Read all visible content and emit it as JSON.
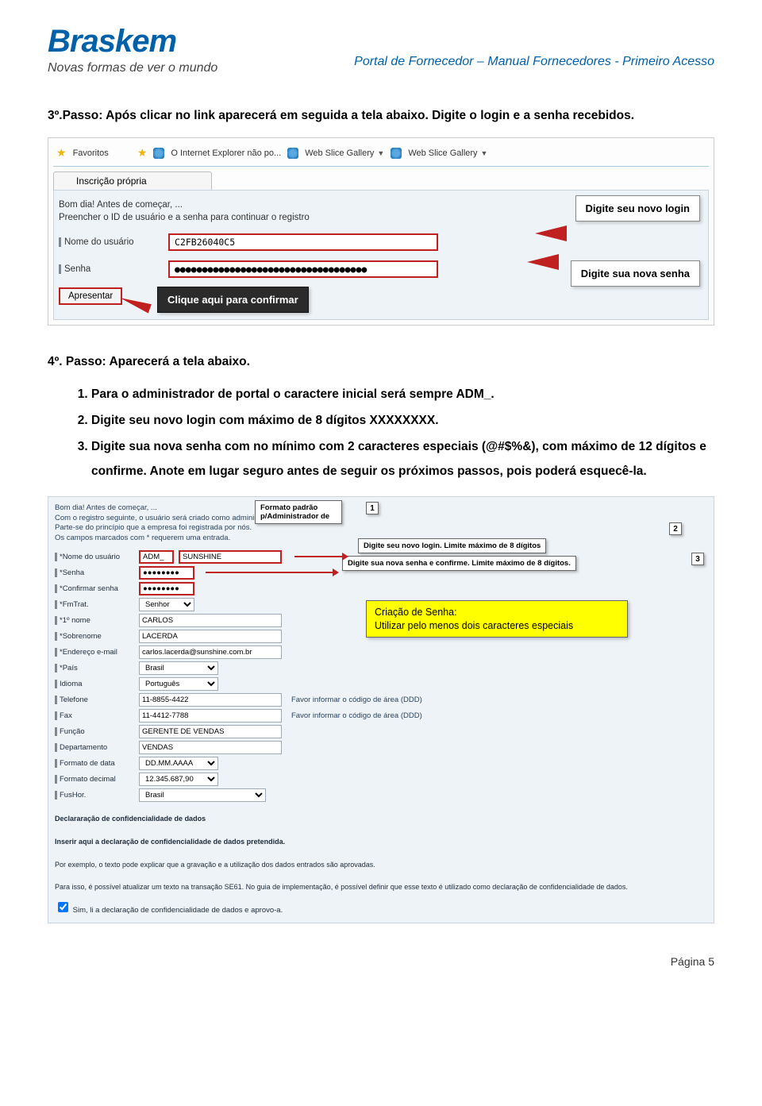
{
  "header": {
    "logo_text": "Braskem",
    "tagline": "Novas formas de ver o mundo",
    "doc_title": "Portal de Fornecedor – Manual Fornecedores - Primeiro Acesso"
  },
  "step3": {
    "text": "3º.Passo: Após clicar no link aparecerá em seguida a tela abaixo. Digite o login e a senha recebidos."
  },
  "shot1": {
    "favorites": "Favoritos",
    "ie_warning": "O Internet Explorer não po...",
    "gallery1": "Web Slice Gallery",
    "gallery2": "Web Slice Gallery",
    "tab_label": "Inscrição própria",
    "greeting": "Bom dia! Antes de começar, ...",
    "instruction": "Preencher o ID de usuário e a senha para continuar o registro",
    "username_label": "Nome do usuário",
    "username_value": "C2FB26040C5",
    "password_label": "Senha",
    "password_value": "●●●●●●●●●●●●●●●●●●●●●●●●●●●●●●●●●●●",
    "submit": "Apresentar",
    "callout_login": "Digite seu novo login",
    "callout_senha": "Digite sua nova senha",
    "callout_confirm": "Clique aqui para confirmar"
  },
  "step4": {
    "title": "4º. Passo: Aparecerá a tela abaixo.",
    "items": [
      "Para o administrador de portal o caractere inicial será sempre ADM_.",
      "Digite seu novo login com máximo de 8 dígitos XXXXXXXX.",
      "Digite sua nova senha com no mínimo com 2 caracteres especiais (@#$%&), com máximo de 12 dígitos e confirme. Anote em lugar seguro antes de seguir os próximos passos, pois poderá esquecê-la."
    ]
  },
  "shot2": {
    "intro_lines": [
      "Bom dia! Antes de começar, ...",
      "Com o registro seguinte, o usuário será criado como administrador da empresa.",
      "Parte-se do princípio que a empresa foi registrada por nós.",
      "Os campos marcados com * requerem uma entrada."
    ],
    "popup_format": "Formato padrão p/Administrador de",
    "num1": "1",
    "num2": "2",
    "num3": "3",
    "tip_login": "Digite seu novo login. Limite máximo de 8 dígitos",
    "tip_senha": "Digite sua nova senha e confirme. Limite máximo de 8 dígitos.",
    "yellow_title": "Criação de Senha:",
    "yellow_body": "Utilizar pelo menos dois caracteres especiais",
    "fields": {
      "nome_usuario": {
        "label": "*Nome do usuário",
        "prefix": "ADM_",
        "value": "SUNSHINE"
      },
      "senha": {
        "label": "*Senha",
        "value": "●●●●●●●●"
      },
      "confirmar": {
        "label": "*Confirmar senha",
        "value": "●●●●●●●●"
      },
      "fmtrat": {
        "label": "*FmTrat.",
        "value": "Senhor"
      },
      "primeiro_nome": {
        "label": "*1º nome",
        "value": "CARLOS"
      },
      "sobrenome": {
        "label": "*Sobrenome",
        "value": "LACERDA"
      },
      "email": {
        "label": "*Endereço e-mail",
        "value": "carlos.lacerda@sunshine.com.br"
      },
      "pais": {
        "label": "*País",
        "value": "Brasil"
      },
      "idioma": {
        "label": "Idioma",
        "value": "Português"
      },
      "telefone": {
        "label": "Telefone",
        "value": "11-8855-4422",
        "hint": "Favor informar o código de área (DDD)"
      },
      "fax": {
        "label": "Fax",
        "value": "11-4412-7788",
        "hint": "Favor informar o código de área (DDD)"
      },
      "funcao": {
        "label": "Função",
        "value": "GERENTE DE VENDAS"
      },
      "departamento": {
        "label": "Departamento",
        "value": "VENDAS"
      },
      "fdata": {
        "label": "Formato de data",
        "value": "DD.MM.AAAA"
      },
      "fdecimal": {
        "label": "Formato decimal",
        "value": "12.345.687,90"
      },
      "fushor": {
        "label": "FusHor.",
        "value": "Brasil"
      }
    },
    "decl_heading": "Declararação de confidencialidade de dados",
    "decl_l1": "Inserir aqui a declaração de confidencialidade de dados pretendida.",
    "decl_l2": "Por exemplo, o texto pode explicar que a gravação e a utilização dos dados entrados são aprovadas.",
    "decl_l3": "Para isso, é possível atualizar um texto na transação SE61. No guia de implementação, é possível definir que esse texto é utilizado como declaração de confidencialidade de dados.",
    "checkbox": "Sim, li a declaração de confidencialidade de dados e aprovo-a."
  },
  "footer": {
    "page": "Página 5"
  }
}
